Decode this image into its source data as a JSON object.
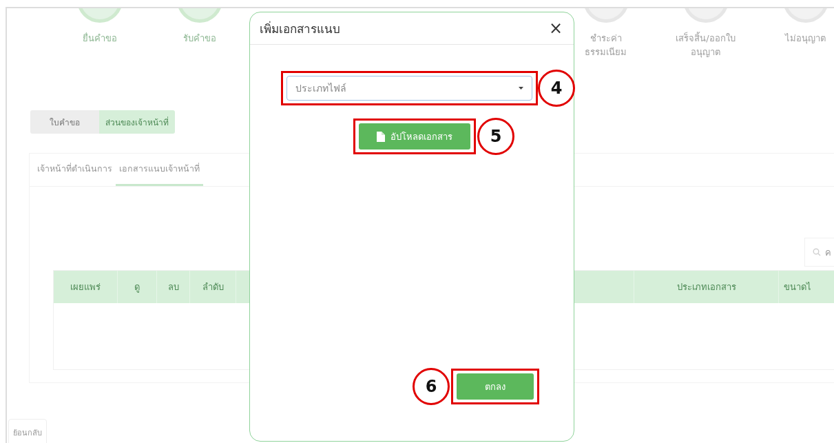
{
  "steps_left": [
    {
      "label": "ยื่นคำขอ",
      "done": true
    },
    {
      "label": "รับคำขอ",
      "done": true
    }
  ],
  "steps_right": [
    {
      "label": "ชำระค่าธรรมเนียม",
      "done": false
    },
    {
      "label": "เสร็จสิ้น/ออกใบอนุญาต",
      "done": false
    },
    {
      "label": "ไม่อนุญาต",
      "done": false
    }
  ],
  "segments": [
    {
      "label": "ใบคำขอ",
      "selected": false
    },
    {
      "label": "ส่วนของเจ้าหน้าที่",
      "selected": true
    }
  ],
  "tabs": [
    {
      "label": "เจ้าหน้าที่ดำเนินการ",
      "selected": false
    },
    {
      "label": "เอกสารแนบเจ้าหน้าที่",
      "selected": true
    }
  ],
  "search": {
    "placeholder": "ค"
  },
  "table": {
    "columns_left": [
      "เผยแพร่",
      "ดู",
      "ลบ",
      "ลำดับ"
    ],
    "columns_right": [
      "ประเภทเอกสาร",
      "ขนาดไ"
    ]
  },
  "back_button": "ย้อนกลับ",
  "modal": {
    "title": "เพิ่มเอกสารแนบ",
    "close": "×",
    "file_type": {
      "placeholder": "ประเภทไฟล์",
      "annotation": "4"
    },
    "upload_button": {
      "label": "อัปโหลดเอกสาร",
      "annotation": "5"
    },
    "ok_button": {
      "label": "ตกลง",
      "annotation": "6"
    }
  }
}
